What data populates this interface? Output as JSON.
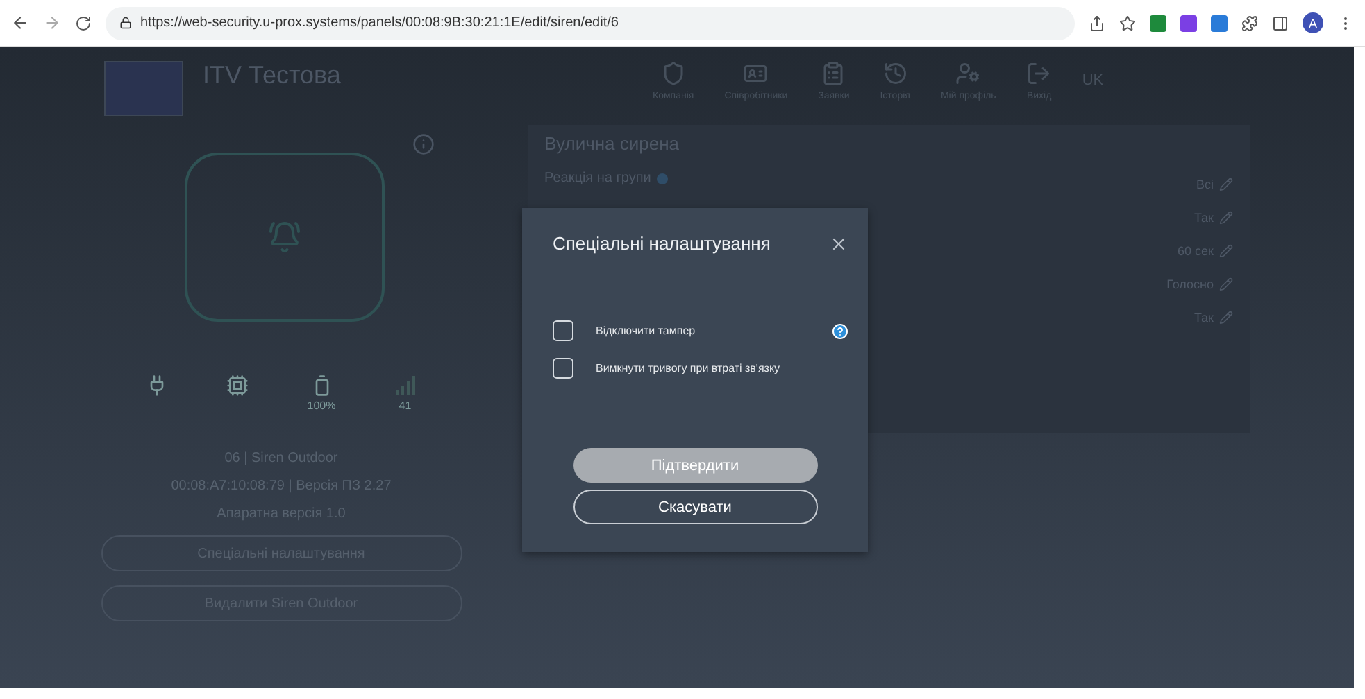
{
  "browser": {
    "url": "https://web-security.u-prox.systems/panels/00:08:9B:30:21:1E/edit/siren/edit/6",
    "avatar": "A"
  },
  "header": {
    "title": "ITV Тестова",
    "language": "UK",
    "nav": [
      {
        "label": "Компанія"
      },
      {
        "label": "Співробітники"
      },
      {
        "label": "Заявки"
      },
      {
        "label": "Історія"
      },
      {
        "label": "Мій профіль"
      },
      {
        "label": "Вихід"
      }
    ]
  },
  "device": {
    "status": [
      {
        "kind": "plug"
      },
      {
        "kind": "sim"
      },
      {
        "kind": "battery",
        "reading": "100%"
      },
      {
        "kind": "signal",
        "reading": "41"
      }
    ],
    "lines": [
      "06 | Siren Outdoor",
      "00:08:A7:10:08:79 | Версія ПЗ 2.27",
      "Апаратна версія 1.0"
    ],
    "buttons": [
      "Спеціальні налаштування",
      "Видалити Siren Outdoor"
    ]
  },
  "settings": {
    "title": "Вулична сирена",
    "group_label": "Реакція на групи",
    "rows": [
      {
        "value": "Всі"
      },
      {
        "value": "Так"
      },
      {
        "value": "60 сек"
      },
      {
        "value": "Голосно"
      },
      {
        "value": "Так"
      }
    ]
  },
  "dialog": {
    "title": "Спеціальні налаштування",
    "options": [
      {
        "label": "Відключити тампер",
        "checked": false,
        "help": true
      },
      {
        "label": "Вимкнути тривогу при втраті зв'язку",
        "checked": false,
        "help": false
      }
    ],
    "confirm": "Підтвердити",
    "cancel": "Скасувати"
  }
}
